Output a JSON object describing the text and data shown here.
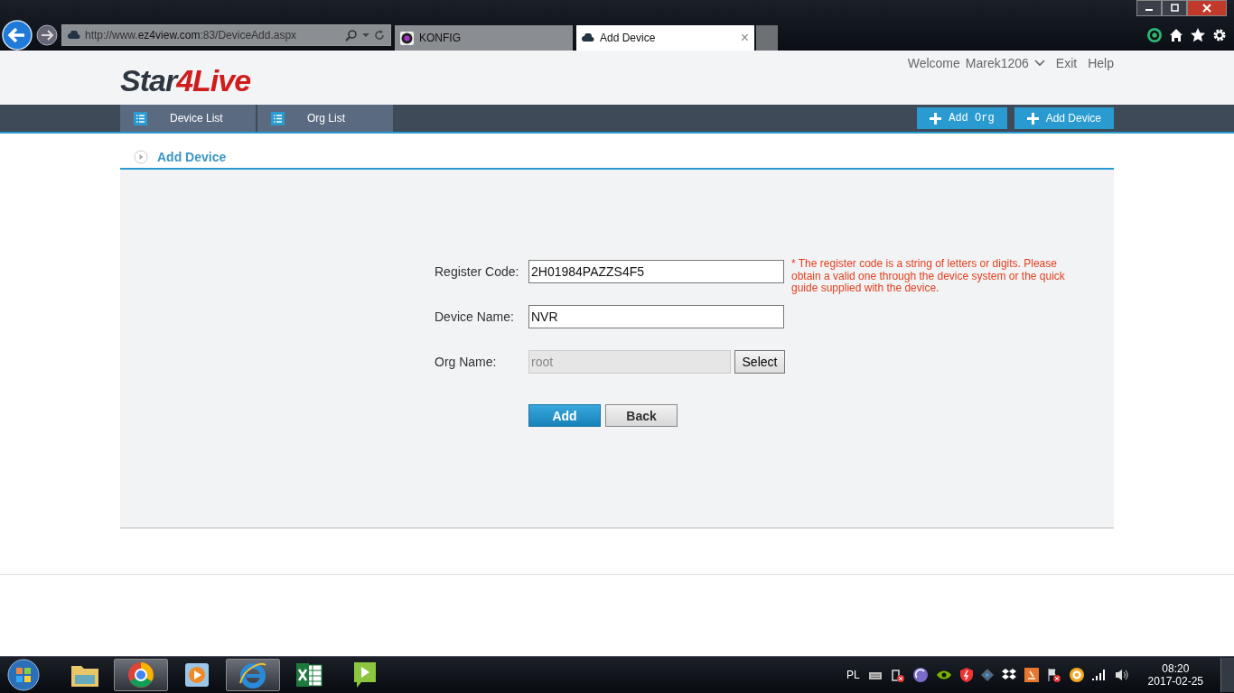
{
  "browser": {
    "address": {
      "prefix": "http://www.",
      "domain": "ez4view.com",
      "suffix": ":83/DeviceAdd.aspx"
    },
    "tabs": [
      {
        "label": "KONFIG",
        "selected": false
      },
      {
        "label": "Add Device",
        "selected": true
      }
    ],
    "close_tab": "×"
  },
  "header": {
    "logo": {
      "part_1": "Star",
      "part_2": "4Live"
    },
    "welcome": "Welcome",
    "user": "Marek1206",
    "links": [
      "Exit",
      "Help"
    ]
  },
  "nav": {
    "items": [
      {
        "label": "Device List"
      },
      {
        "label": "Org List"
      }
    ],
    "actions": [
      {
        "label": "Add Org",
        "mono": true
      },
      {
        "label": "Add Device",
        "mono": false
      }
    ]
  },
  "section_title": "Add Device",
  "form": {
    "fields": [
      {
        "label": "Register Code:",
        "value": "2H01984PAZZS4F5",
        "kind": "text",
        "note": "* The register code is a string of letters or digits. Please obtain a valid one through the device system or the quick guide supplied with the device."
      },
      {
        "label": "Device Name:",
        "value": "NVR",
        "kind": "text"
      },
      {
        "label": "Org Name:",
        "value": "root",
        "kind": "select",
        "button": "Select",
        "disabled": true
      }
    ],
    "buttons": [
      {
        "label": "Add",
        "primary": true
      },
      {
        "label": "Back",
        "primary": false
      }
    ]
  },
  "taskbar": {
    "apps": [
      {
        "kind": "folder",
        "selected": false
      },
      {
        "kind": "chrome",
        "selected": true
      },
      {
        "kind": "media",
        "selected": false
      },
      {
        "kind": "ie",
        "selected": true
      },
      {
        "kind": "excel",
        "selected": false
      },
      {
        "kind": "play",
        "selected": false
      }
    ],
    "language": "PL",
    "time": "08:20",
    "date": "2017-02-25"
  }
}
